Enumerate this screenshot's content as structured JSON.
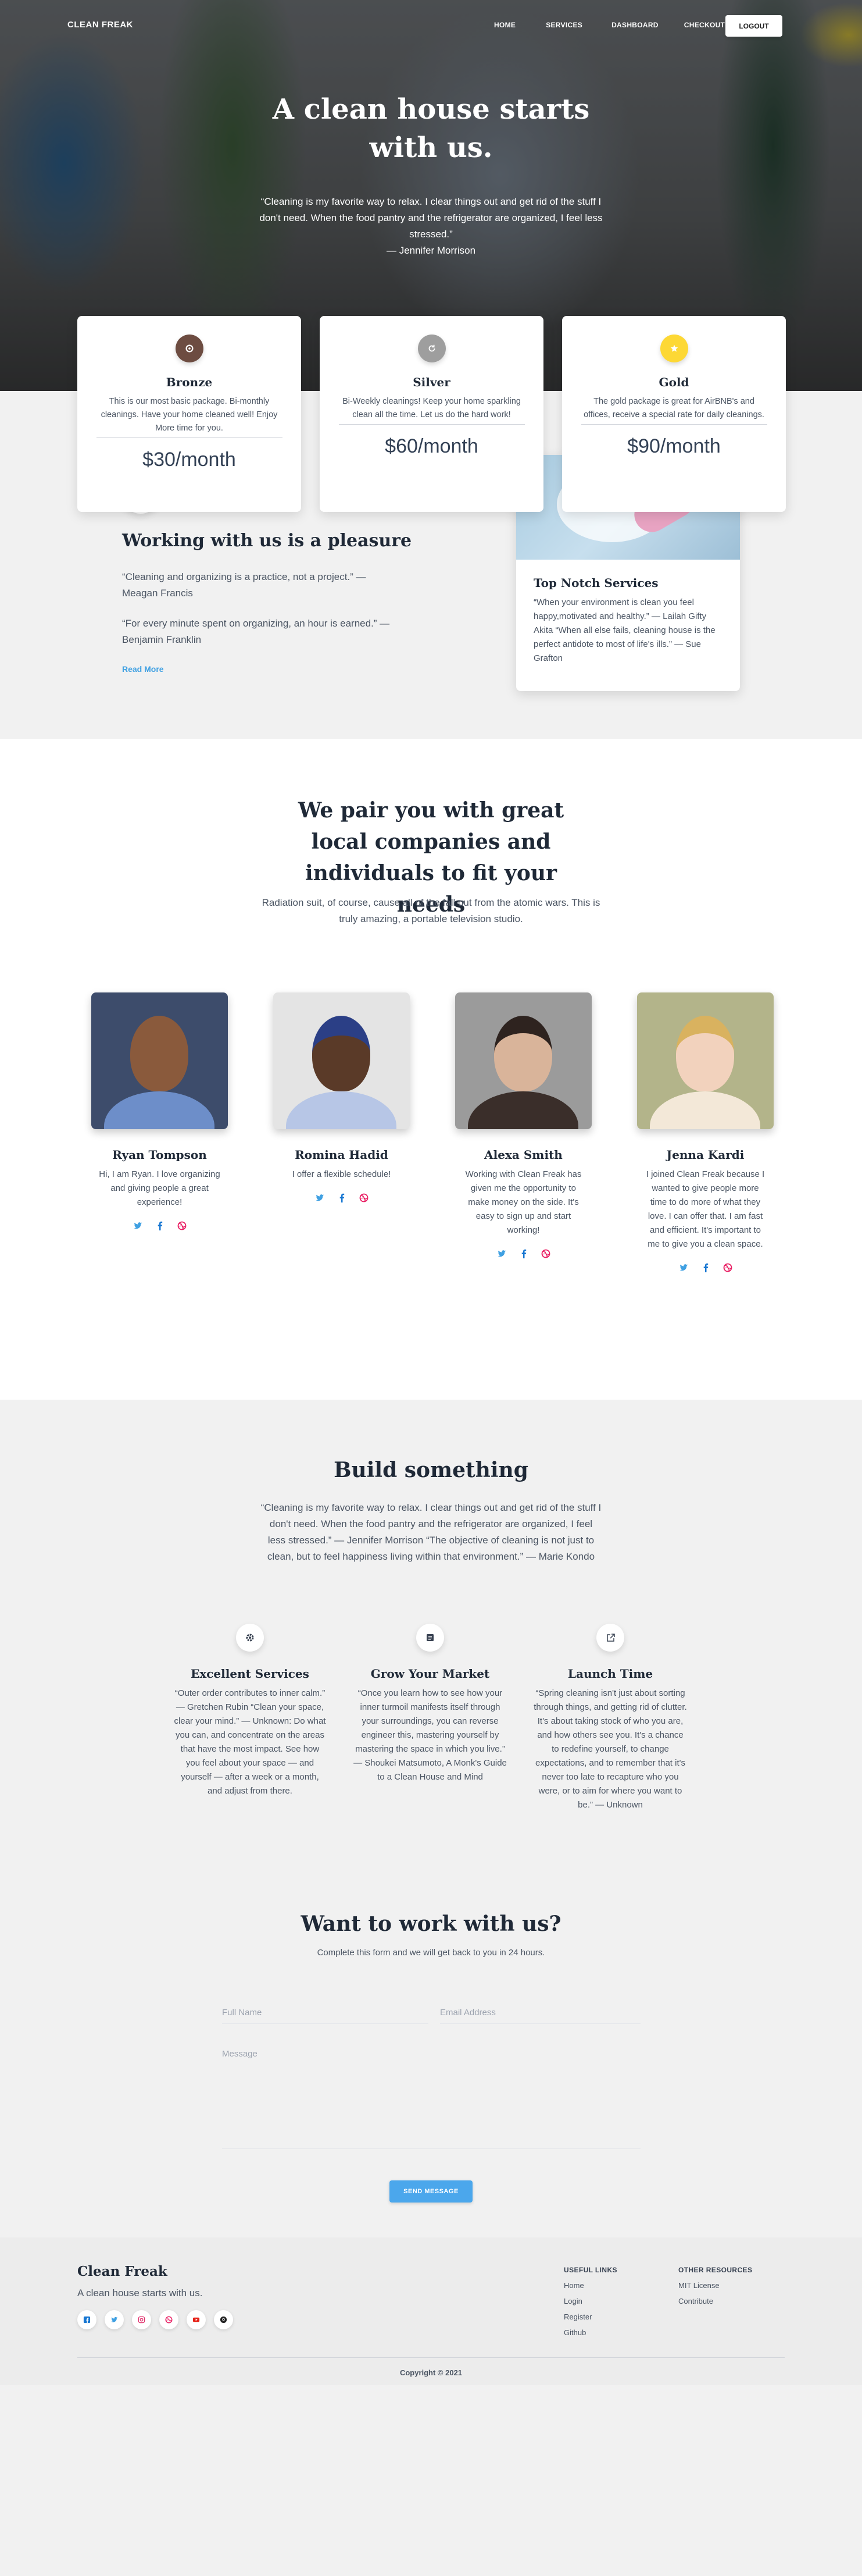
{
  "nav": {
    "brand": "CLEAN FREAK",
    "links": [
      "HOME",
      "SERVICES",
      "DASHBOARD",
      "CHECKOUT"
    ],
    "logout": "LOGOUT"
  },
  "hero": {
    "title": "A clean house starts with us.",
    "quote": "“Cleaning is my favorite way to relax. I clear things out and get rid of the stuff I don't need. When the food pantry and the refrigerator are organized, I feel less stressed.”",
    "author": "— Jennifer Morrison"
  },
  "plans": [
    {
      "name": "Bronze",
      "desc": "This is our most basic package. Bi-monthly cleanings. Have your home cleaned well! Enjoy More time for you.",
      "price": "$30/month",
      "color": "#6d4c41",
      "icon": "circle-dot-icon"
    },
    {
      "name": "Silver",
      "desc": "Bi-Weekly cleanings! Keep your home sparkling clean all the time. Let us do the hard work!",
      "price": "$60/month",
      "color": "#9e9e9e",
      "icon": "refresh-icon"
    },
    {
      "name": "Gold",
      "desc": "The gold package is great for AirBNB's and offices, receive a special rate for daily cleanings.",
      "price": "$90/month",
      "color": "#fdd835",
      "icon": "star-icon"
    }
  ],
  "pleasure": {
    "title": "Working with us is a pleasure",
    "quote1": "“Cleaning and organizing is a practice, not a project.” — Meagan Francis",
    "quote2": "“For every minute spent on organizing, an hour is earned.” — Benjamin Franklin",
    "link": "Read More",
    "card_title": "Top Notch Services",
    "card_text": "“When your environment is clean you feel happy,motivated and healthy.” ― Lailah Gifty Akita “When all else fails, cleaning house is the perfect antidote to most of life's ills.” ― Sue Grafton"
  },
  "pair": {
    "title": "We pair you with great local companies and individuals to fit your needs",
    "subtitle": "Radiation suit, of course, cause all of the fall out from the atomic wars. This is truly amazing, a portable television studio."
  },
  "team": [
    {
      "name": "Ryan Tompson",
      "bio": "Hi, I am Ryan. I love organizing and giving people a great experience!",
      "bg": "#3d4c6b",
      "skin": "#8a5a3c",
      "shirt": "#6d8ec9"
    },
    {
      "name": "Romina Hadid",
      "bio": "I offer a flexible schedule!",
      "bg": "#e4e4e4",
      "skin": "#5a3a28",
      "shirt": "#b7c6e6"
    },
    {
      "name": "Alexa Smith",
      "bio": "Working with Clean Freak has given me the opportunity to make money on the side. It's easy to sign up and start working!",
      "bg": "#9b9b9b",
      "skin": "#d9b49a",
      "shirt": "#3a2e2a"
    },
    {
      "name": "Jenna Kardi",
      "bio": "I joined Clean Freak because I wanted to give people more time to do more of what they love. I can offer that. I am fast and efficient. It's important to me to give you a clean space.",
      "bg": "#b3b48a",
      "skin": "#f2d2bd",
      "shirt": "#f3e8d8"
    }
  ],
  "build": {
    "title": "Build something",
    "quote": "“Cleaning is my favorite way to relax. I clear things out and get rid of the stuff I don't need. When the food pantry and the refrigerator are organized, I feel less stressed.” ― Jennifer Morrison “The objective of cleaning is not just to clean, but to feel happiness living within that environment.” ― Marie Kondo",
    "features": [
      {
        "title": "Excellent Services",
        "text": "“Outer order contributes to inner calm.” ― Gretchen Rubin “Clean your space, clear your mind.” ― Unknown: Do what you can, and concentrate on the areas that have the most impact. See how you feel about your space — and yourself — after a week or a month, and adjust from there.",
        "icon": "gear-icon"
      },
      {
        "title": "Grow Your Market",
        "text": "“Once you learn how to see how your inner turmoil manifests itself through your surroundings, you can reverse engineer this, mastering yourself by mastering the space in which you live.” ― Shoukei Matsumoto, A Monk's Guide to a Clean House and Mind",
        "icon": "document-icon"
      },
      {
        "title": "Launch Time",
        "text": "“Spring cleaning isn't just about sorting through things, and getting rid of clutter. It's about taking stock of who you are, and how others see you. It's a chance to redefine yourself, to change expectations, and to remember that it's never too late to recapture who you were, or to aim for where you want to be.” — Unknown",
        "icon": "external-link-icon"
      }
    ]
  },
  "contact": {
    "title": "Want to work with us?",
    "subtitle": "Complete this form and we will get back to you in 24 hours.",
    "name_placeholder": "Full Name",
    "email_placeholder": "Email Address",
    "message_placeholder": "Message",
    "submit": "SEND MESSAGE"
  },
  "footer": {
    "brand": "Clean Freak",
    "tagline": "A clean house starts with us.",
    "col1_title": "USEFUL LINKS",
    "col1_links": [
      "Home",
      "Login",
      "Register",
      "Github"
    ],
    "col2_title": "OTHER RESOURCES",
    "col2_links": [
      "MIT License",
      "Contribute"
    ],
    "copyright": "Copyright © 2021"
  }
}
